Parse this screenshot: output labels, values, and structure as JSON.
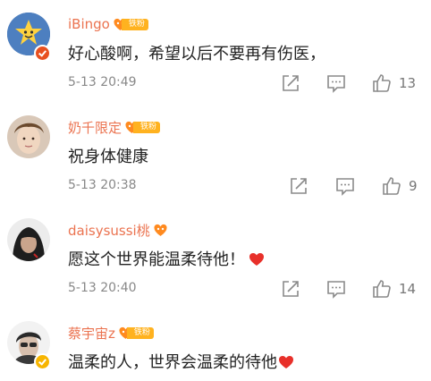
{
  "comments": [
    {
      "username": "iBingo",
      "fan_badge": "铁粉",
      "text": "好心酸啊，希望以后不要再有伤医，",
      "time": "5-13 20:49",
      "likes": "13",
      "avatar_icon": "yellow-smiley-avatar",
      "verified_color": "#e85020"
    },
    {
      "username": "奶千限定",
      "fan_badge": "铁粉",
      "text": "祝身体健康",
      "time": "5-13 20:38",
      "likes": "9",
      "avatar_icon": "photo-avatar"
    },
    {
      "username": "daisysussi桃",
      "fan_badge": "",
      "text": "愿这个世界能温柔待他！",
      "time": "5-13 20:40",
      "likes": "14",
      "avatar_icon": "photo-avatar",
      "emoji": "red-heart-icon"
    },
    {
      "username": "蔡宇宙z",
      "fan_badge": "铁粉",
      "text": "温柔的人，世界会温柔的待他",
      "avatar_icon": "photo-avatar",
      "verified_color": "#f7b500",
      "emoji": "red-heart-icon"
    }
  ],
  "colors": {
    "username": "#eb7350",
    "fan_badge": "#ffb21f",
    "heart_emoji": "#e8302a",
    "icon_gray": "#8a8a8a"
  }
}
